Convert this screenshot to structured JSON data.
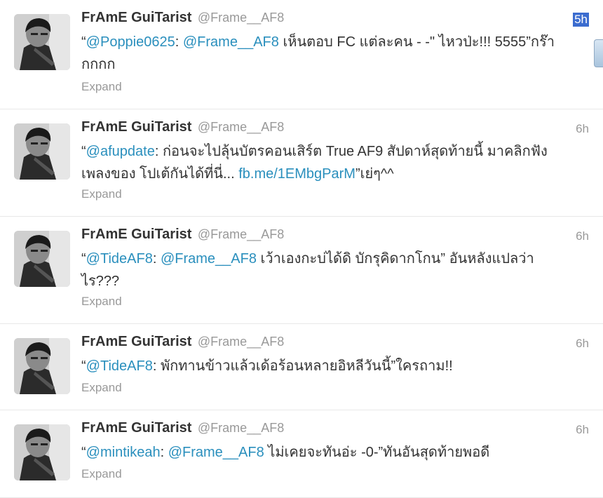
{
  "tweets": [
    {
      "name": "FrAmE GuiTarist",
      "handle": "@Frame__AF8",
      "time": "5h",
      "segments": [
        {
          "t": "“",
          "link": false
        },
        {
          "t": "@Poppie0625",
          "link": true
        },
        {
          "t": ": ",
          "link": false
        },
        {
          "t": "@Frame__AF8",
          "link": true
        },
        {
          "t": " เห็นตอบ FC แต่ละคน - -\" ไหวป่ะ!!! 5555”กร๊ากกกก",
          "link": false
        }
      ],
      "expand": "Expand"
    },
    {
      "name": "FrAmE GuiTarist",
      "handle": "@Frame__AF8",
      "time": "6h",
      "segments": [
        {
          "t": "“",
          "link": false
        },
        {
          "t": "@afupdate",
          "link": true
        },
        {
          "t": ": ก่อนจะไปลุ้นบัตรคอนเสิร์ต True AF9 สัปดาห์สุดท้ายนี้ มาคลิกฟังเพลงของ โปเต้กันได้ที่นี่... ",
          "link": false
        },
        {
          "t": "fb.me/1EMbgParM",
          "link": true
        },
        {
          "t": "”เย่ๆ^^",
          "link": false
        }
      ],
      "expand": "Expand"
    },
    {
      "name": "FrAmE GuiTarist",
      "handle": "@Frame__AF8",
      "time": "6h",
      "segments": [
        {
          "t": "“",
          "link": false
        },
        {
          "t": "@TideAF8",
          "link": true
        },
        {
          "t": ": ",
          "link": false
        },
        {
          "t": "@Frame__AF8",
          "link": true
        },
        {
          "t": " เว้าเองกะบ่ได้ดิ บักรุคิดากโกน” อันหลังแปลว่าไร???",
          "link": false
        }
      ],
      "expand": "Expand"
    },
    {
      "name": "FrAmE GuiTarist",
      "handle": "@Frame__AF8",
      "time": "6h",
      "segments": [
        {
          "t": "“",
          "link": false
        },
        {
          "t": "@TideAF8",
          "link": true
        },
        {
          "t": ": พักทานข้าวแล้วเด้อร้อนหลายอิหลีวันนี้”ใครถาม!!",
          "link": false
        }
      ],
      "expand": "Expand"
    },
    {
      "name": "FrAmE GuiTarist",
      "handle": "@Frame__AF8",
      "time": "6h",
      "segments": [
        {
          "t": "“",
          "link": false
        },
        {
          "t": "@mintikeah",
          "link": true
        },
        {
          "t": ": ",
          "link": false
        },
        {
          "t": "@Frame__AF8",
          "link": true
        },
        {
          "t": " ไม่เคยจะทันอ่ะ -0-”ทันอันสุดท้ายพอดี",
          "link": false
        }
      ],
      "expand": "Expand"
    }
  ]
}
